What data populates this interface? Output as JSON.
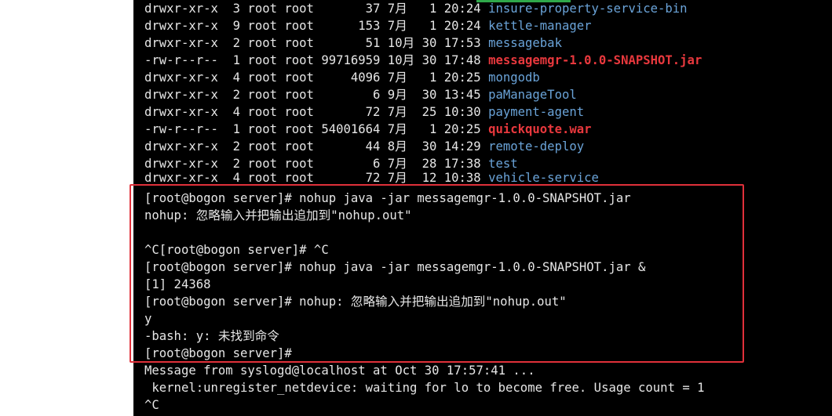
{
  "terminal": {
    "colors": {
      "background": "#000000",
      "text": "#e6e6e6",
      "directory": "#6aa3d8",
      "archive": "#e8383d",
      "highlight_border": "#e0303a"
    },
    "listing": [
      {
        "perms": "drwxr-xr-x",
        "links": "3",
        "owner": "root",
        "group": "root",
        "size": "37",
        "month": "7月",
        "day": "1",
        "time": "20:24",
        "name": "insure-property-service-bin",
        "kind": "dir"
      },
      {
        "perms": "drwxr-xr-x",
        "links": "9",
        "owner": "root",
        "group": "root",
        "size": "153",
        "month": "7月",
        "day": "1",
        "time": "20:24",
        "name": "kettle-manager",
        "kind": "dir"
      },
      {
        "perms": "drwxr-xr-x",
        "links": "2",
        "owner": "root",
        "group": "root",
        "size": "51",
        "month": "10月",
        "day": "30",
        "time": "17:53",
        "name": "messagebak",
        "kind": "dir"
      },
      {
        "perms": "-rw-r--r--",
        "links": "1",
        "owner": "root",
        "group": "root",
        "size": "99716959",
        "month": "10月",
        "day": "30",
        "time": "17:48",
        "name": "messagemgr-1.0.0-SNAPSHOT.jar",
        "kind": "archive"
      },
      {
        "perms": "drwxr-xr-x",
        "links": "4",
        "owner": "root",
        "group": "root",
        "size": "4096",
        "month": "7月",
        "day": "1",
        "time": "20:25",
        "name": "mongodb",
        "kind": "dir"
      },
      {
        "perms": "drwxr-xr-x",
        "links": "2",
        "owner": "root",
        "group": "root",
        "size": "6",
        "month": "9月",
        "day": "30",
        "time": "13:45",
        "name": "paManageTool",
        "kind": "dir"
      },
      {
        "perms": "drwxr-xr-x",
        "links": "4",
        "owner": "root",
        "group": "root",
        "size": "72",
        "month": "7月",
        "day": "25",
        "time": "10:30",
        "name": "payment-agent",
        "kind": "dir"
      },
      {
        "perms": "-rw-r--r--",
        "links": "1",
        "owner": "root",
        "group": "root",
        "size": "54001664",
        "month": "7月",
        "day": "1",
        "time": "20:25",
        "name": "quickquote.war",
        "kind": "archive"
      },
      {
        "perms": "drwxr-xr-x",
        "links": "2",
        "owner": "root",
        "group": "root",
        "size": "44",
        "month": "8月",
        "day": "30",
        "time": "14:29",
        "name": "remote-deploy",
        "kind": "dir"
      },
      {
        "perms": "drwxr-xr-x",
        "links": "2",
        "owner": "root",
        "group": "root",
        "size": "6",
        "month": "7月",
        "day": "28",
        "time": "17:38",
        "name": "test",
        "kind": "dir"
      },
      {
        "perms": "drwxr-xr-x",
        "links": "4",
        "owner": "root",
        "group": "root",
        "size": "72",
        "month": "7月",
        "day": "12",
        "time": "10:38",
        "name": "vehicle-service",
        "kind": "dir"
      }
    ],
    "session": [
      "[root@bogon server]# nohup java -jar messagemgr-1.0.0-SNAPSHOT.jar",
      "nohup: 忽略输入并把输出追加到\"nohup.out\"",
      "",
      "^C[root@bogon server]# ^C",
      "[root@bogon server]# nohup java -jar messagemgr-1.0.0-SNAPSHOT.jar &",
      "[1] 24368",
      "[root@bogon server]# nohup: 忽略输入并把输出追加到\"nohup.out\"",
      "y",
      "-bash: y: 未找到命令",
      "[root@bogon server]#"
    ],
    "syslog": [
      "Message from syslogd@localhost at Oct 30 17:57:41 ...",
      " kernel:unregister_netdevice: waiting for lo to become free. Usage count = 1",
      "^C"
    ]
  }
}
